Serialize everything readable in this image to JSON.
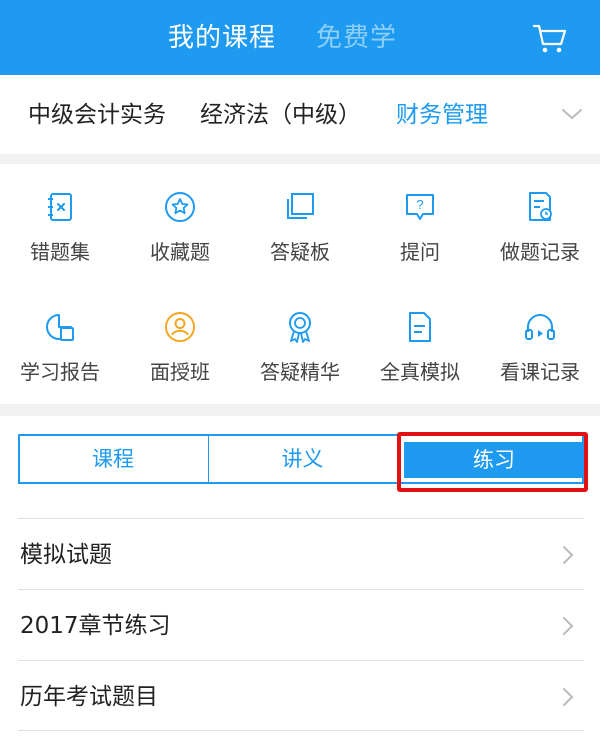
{
  "header": {
    "tab_active": "我的课程",
    "tab_inactive": "免费学",
    "cart_icon": "cart-icon"
  },
  "subjects": {
    "items": [
      "中级会计实务",
      "经济法（中级）",
      "财务管理"
    ],
    "selected": "财务管理",
    "expand_icon": "chevron-down-icon"
  },
  "grid": {
    "items": [
      {
        "label": "错题集",
        "icon": "wrong-notebook-icon"
      },
      {
        "label": "收藏题",
        "icon": "star-circle-icon"
      },
      {
        "label": "答疑板",
        "icon": "board-icon"
      },
      {
        "label": "提问",
        "icon": "question-bubble-icon"
      },
      {
        "label": "做题记录",
        "icon": "record-icon"
      },
      {
        "label": "学习报告",
        "icon": "report-icon"
      },
      {
        "label": "面授班",
        "icon": "teacher-icon"
      },
      {
        "label": "答疑精华",
        "icon": "award-icon"
      },
      {
        "label": "全真模拟",
        "icon": "document-icon"
      },
      {
        "label": "看课记录",
        "icon": "headphones-icon"
      }
    ]
  },
  "tabs": {
    "items": [
      "课程",
      "讲义",
      "练习"
    ],
    "selected": "练习"
  },
  "list": {
    "items": [
      "模拟试题",
      "2017章节练习",
      "历年考试题目"
    ]
  },
  "colors": {
    "brand": "#1e9af0",
    "highlight": "#e21010",
    "accent_orange": "#f5a623"
  }
}
